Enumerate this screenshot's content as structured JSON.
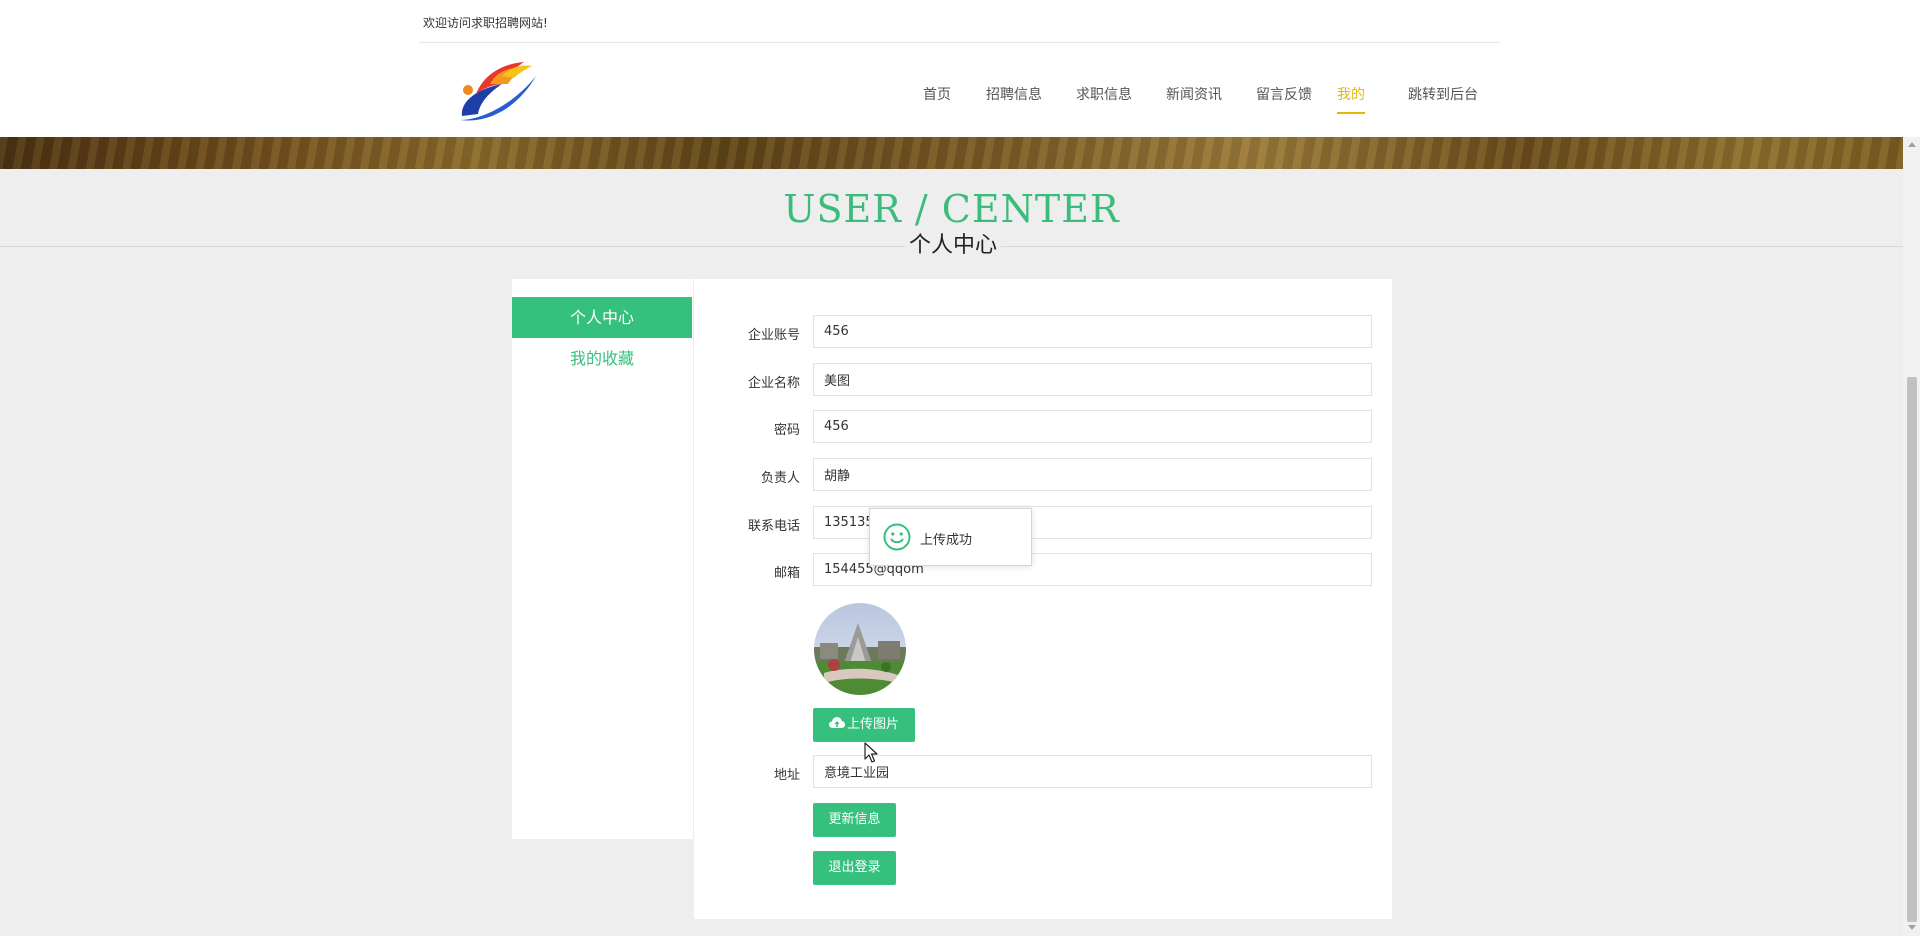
{
  "header": {
    "welcome": "欢迎访问求职招聘网站!",
    "nav": [
      {
        "label": "首页",
        "active": false
      },
      {
        "label": "招聘信息",
        "active": false
      },
      {
        "label": "求职信息",
        "active": false
      },
      {
        "label": "新闻资讯",
        "active": false
      },
      {
        "label": "留言反馈",
        "active": false
      },
      {
        "label": "我的",
        "active": true
      },
      {
        "label": "跳转到后台",
        "active": false
      }
    ]
  },
  "title": {
    "en": "USER / CENTER",
    "cn": "个人中心"
  },
  "sidebar": {
    "items": [
      {
        "label": "个人中心",
        "active": true
      },
      {
        "label": "我的收藏",
        "active": false
      }
    ]
  },
  "form": {
    "fields": [
      {
        "label": "企业账号",
        "value": "456"
      },
      {
        "label": "企业名称",
        "value": "美图"
      },
      {
        "label": "密码",
        "value": "456"
      },
      {
        "label": "负责人",
        "value": "胡静"
      },
      {
        "label": "联系电话",
        "value": "13513513513"
      },
      {
        "label": "邮箱",
        "value": "154455@qqom"
      }
    ],
    "upload_label": "上传图片",
    "address": {
      "label": "地址",
      "value": "意境工业园"
    },
    "update_label": "更新信息",
    "logout_label": "退出登录"
  },
  "toast": {
    "message": "上传成功",
    "icon": "smile-icon"
  },
  "colors": {
    "accent": "#36c07e",
    "active_nav": "#e6b800"
  }
}
